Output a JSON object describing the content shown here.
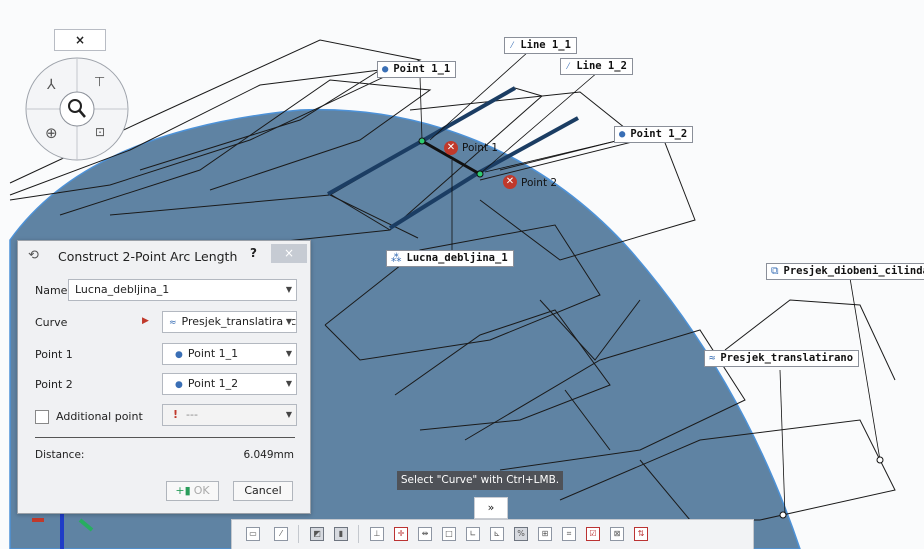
{
  "viewport": {
    "labels": {
      "line1_1": "Line 1_1",
      "line1_2": "Line 1_2",
      "point1_1": "Point 1_1",
      "point1_2": "Point 1_2",
      "point1": "Point 1",
      "point2": "Point 2",
      "lucna": "Lucna_debljina_1",
      "presjek_diobeni": "Presjek_diobeni_cilinda",
      "presjek_translatirano": "Presjek_translatirano"
    },
    "colors": {
      "surface": "#5f83a3",
      "surface_edge": "#4d92d8",
      "error": "#c0392b"
    }
  },
  "navigator": {
    "close_label": "×"
  },
  "dialog": {
    "title": "Construct 2-Point Arc Length",
    "help_label": "?",
    "close_label": "×",
    "name_label": "Name",
    "name_value": "Lucna_debljina_1",
    "curve_label": "Curve",
    "curve_value": "Presjek_translatiranc",
    "point1_label": "Point 1",
    "point1_value": "Point 1_1",
    "point2_label": "Point 2",
    "point2_value": "Point 1_2",
    "additional_label": "Additional point",
    "additional_value": "---",
    "distance_label": "Distance:",
    "distance_value": "6.049mm",
    "ok_label": "OK",
    "cancel_label": "Cancel"
  },
  "tooltip": {
    "text": "Select \"Curve\" with Ctrl+LMB."
  },
  "toolbar": {
    "expand_label": "»"
  }
}
